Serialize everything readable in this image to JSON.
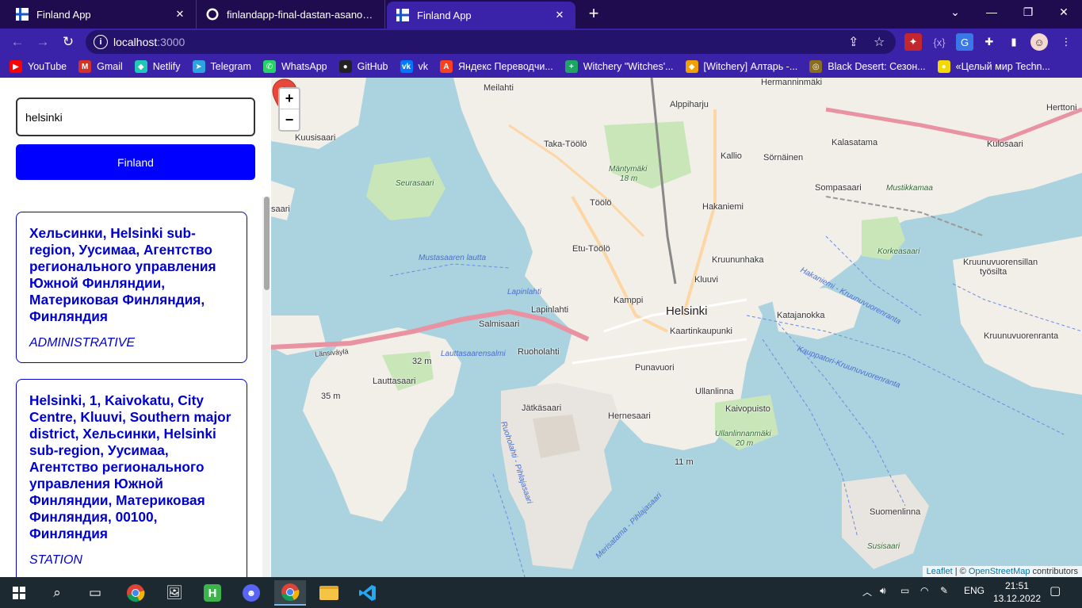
{
  "browser": {
    "tabs": [
      {
        "title": "Finland App",
        "active": false,
        "icon": "finland-flag-icon"
      },
      {
        "title": "finlandapp-final-dastan-asanov/s",
        "active": false,
        "icon": "github-icon"
      },
      {
        "title": "Finland App",
        "active": true,
        "icon": "finland-flag-icon"
      }
    ],
    "address": {
      "host": "localhost",
      "port": ":3000"
    },
    "bookmarks": [
      {
        "label": "YouTube",
        "color": "#ff0000",
        "glyph": "▶"
      },
      {
        "label": "Gmail",
        "color": "#d93025",
        "glyph": "M"
      },
      {
        "label": "Netlify",
        "color": "#20c6b7",
        "glyph": "◆"
      },
      {
        "label": "Telegram",
        "color": "#2aa3df",
        "glyph": "➤"
      },
      {
        "label": "WhatsApp",
        "color": "#25d366",
        "glyph": "✆"
      },
      {
        "label": "GitHub",
        "color": "#222222",
        "glyph": "●"
      },
      {
        "label": "vk",
        "color": "#0077ff",
        "glyph": "vk"
      },
      {
        "label": "Яндекс Переводчи...",
        "color": "#fc3f1d",
        "glyph": "A"
      },
      {
        "label": "Witchery \"Witches'...",
        "color": "#1fa463",
        "glyph": "+"
      },
      {
        "label": "[Witchery] Алтарь -...",
        "color": "#f0a100",
        "glyph": "◆"
      },
      {
        "label": "Black Desert: Сезон...",
        "color": "#8a6d1e",
        "glyph": "◎"
      },
      {
        "label": "«Целый мир Techn...",
        "color": "#f5d800",
        "glyph": "●"
      }
    ]
  },
  "sidebar": {
    "search_value": "helsinki",
    "search_button": "Finland",
    "results": [
      {
        "name": "Хельсинки, Helsinki sub-region, Уусимаа, Агентство регионального управления Южной Финляндии, Материковая Финляндия, Финляндия",
        "type": "ADMINISTRATIVE"
      },
      {
        "name": "Helsinki, 1, Kaivokatu, City Centre, Kluuvi, Southern major district, Хельсинки, Helsinki sub-region, Уусимаа, Агентство регионального управления Южной Финляндии, Материковая Финляндия, 00100, Финляндия",
        "type": "STATION"
      }
    ]
  },
  "map": {
    "zoom_in": "+",
    "zoom_out": "−",
    "attribution": {
      "leaflet": "Leaflet",
      "sep": " | © ",
      "osm": "OpenStreetMap",
      "rest": " contributors"
    },
    "labels": {
      "meilahti": "Meilahti",
      "hermanninmaki": "Hermanninmäki",
      "herttoniemi": "Herttoni",
      "alppiharju": "Alppiharju",
      "kuusisaari": "Kuusisaari",
      "taka_toolo": "Taka-Töölö",
      "kallio": "Kallio",
      "sornainen": "Sörnäinen",
      "kalasatama": "Kalasatama",
      "kulosaari": "Kulosaari",
      "mantymaki": "Mäntymäki",
      "mantymaki_h": "18 m",
      "seurasaari": "Seurasaari",
      "sompasaari": "Sompasaari",
      "mustikkamaa": "Mustikkamaa",
      "saari": "saari",
      "toolo": "Töölö",
      "hakaniemi": "Hakaniemi",
      "korkeasaari": "Korkeasaari",
      "mustasaaren_lautta": "Mustasaaren lautta",
      "etu_toolo": "Etu-Töölö",
      "kruununhaka": "Kruununhaka",
      "kruunuvuorensillan": "Kruunuvuorensillan",
      "tyosilta": "työsilta",
      "lapinlahti_water": "Lapinlahti",
      "kluuvi": "Kluuvi",
      "kamppi": "Kamppi",
      "helsinki": "Helsinki",
      "lapinlahti": "Lapinlahti",
      "katajanokka": "Katajanokka",
      "salmisaari": "Salmisaari",
      "kaartinkaupunki": "Kaartinkaupunki",
      "kruunuvuorenranta": "Kruunuvuorenranta",
      "ruoholahti": "Ruoholahti",
      "lauttasaarensalmi": "Lauttasaarensalmi",
      "h32": "32 m",
      "punavuori": "Punavuori",
      "lauttasaari": "Lauttasaari",
      "h35": "35 m",
      "ullanlinna": "Ullanlinna",
      "jatkasaari": "Jätkäsaari",
      "kaivopuisto": "Kaivopuisto",
      "hernesaari": "Hernesaari",
      "ullanlinnanmaki": "Ullanlinnanmäki",
      "h20": "20 m",
      "h11": "11 m",
      "suomenlinna": "Suomenlinna",
      "susisaari": "Susisaari",
      "hakaniemi_kruunu": "Hakaniemi - Kruunuvuorenranta",
      "kauppatori": "Kauppatori-Kruunuvuorenranta",
      "merisatama": "Merisatama - Pihlajasaari",
      "ruoholahti_pihl": "Ruoholahti - Pihlajasaari",
      "lansivayla": "Länsiväylä"
    }
  },
  "taskbar": {
    "lang": "ENG",
    "time": "21:51",
    "date": "13.12.2022"
  }
}
